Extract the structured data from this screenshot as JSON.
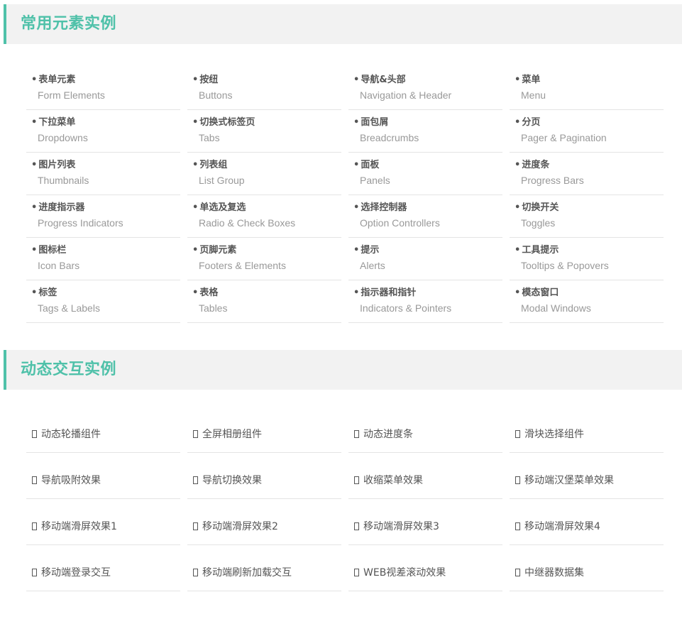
{
  "sections": [
    {
      "title": "常用元素实例"
    },
    {
      "title": "动态交互实例"
    }
  ],
  "common_elements": [
    {
      "cn": "表单元素",
      "en": "Form Elements"
    },
    {
      "cn": "按纽",
      "en": "Buttons"
    },
    {
      "cn": "导航&头部",
      "en": "Navigation & Header"
    },
    {
      "cn": "菜单",
      "en": "Menu"
    },
    {
      "cn": "下拉菜单",
      "en": "Dropdowns"
    },
    {
      "cn": "切换式标签页",
      "en": "Tabs"
    },
    {
      "cn": "面包屑",
      "en": "Breadcrumbs"
    },
    {
      "cn": "分页",
      "en": "Pager & Pagination"
    },
    {
      "cn": "图片列表",
      "en": "Thumbnails"
    },
    {
      "cn": "列表组",
      "en": "List Group"
    },
    {
      "cn": "面板",
      "en": "Panels"
    },
    {
      "cn": "进度条",
      "en": "Progress Bars"
    },
    {
      "cn": "进度指示器",
      "en": "Progress Indicators"
    },
    {
      "cn": "单选及复选",
      "en": "Radio & Check Boxes"
    },
    {
      "cn": "选择控制器",
      "en": "Option Controllers"
    },
    {
      "cn": "切换开关",
      "en": "Toggles"
    },
    {
      "cn": "图标栏",
      "en": "Icon Bars"
    },
    {
      "cn": "页脚元素",
      "en": "Footers & Elements"
    },
    {
      "cn": "提示",
      "en": "Alerts"
    },
    {
      "cn": "工具提示",
      "en": "Tooltips & Popovers"
    },
    {
      "cn": "标签",
      "en": "Tags & Labels"
    },
    {
      "cn": "表格",
      "en": "Tables"
    },
    {
      "cn": "指示器和指针",
      "en": "Indicators & Pointers"
    },
    {
      "cn": "模态窗口",
      "en": "Modal Windows"
    }
  ],
  "interactive_examples": [
    "动态轮播组件",
    "全屏相册组件",
    "动态进度条",
    "滑块选择组件",
    "导航吸附效果",
    "导航切换效果",
    "收缩菜单效果",
    "移动端汉堡菜单效果",
    "移动端滑屏效果1",
    "移动端滑屏效果2",
    "移动端滑屏效果3",
    "移动端滑屏效果4",
    "移动端登录交互",
    "移动端刷新加载交互",
    "WEB视差滚动效果",
    "中继器数据集"
  ],
  "bullet": "•"
}
